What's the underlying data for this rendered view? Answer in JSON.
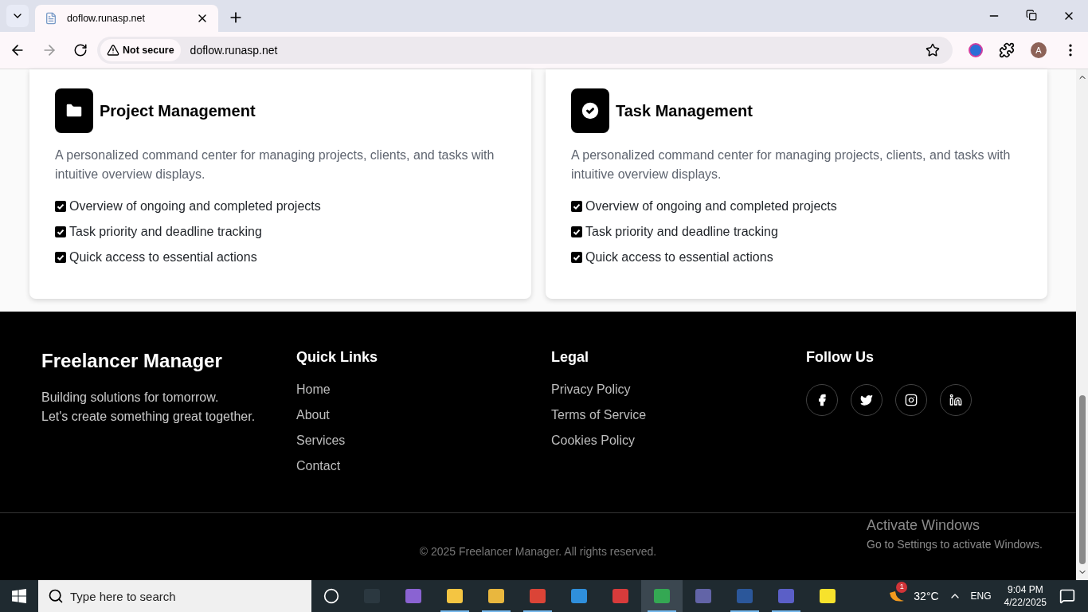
{
  "browser": {
    "tab_title": "doflow.runasp.net",
    "security": "Not secure",
    "url": "doflow.runasp.net",
    "profile_initial": "A"
  },
  "cards": [
    {
      "kind": "folder",
      "title": "Project Management",
      "description": "A personalized command center for managing projects, clients, and tasks with intuitive overview displays.",
      "features": [
        "Overview of ongoing and completed projects",
        "Task priority and deadline tracking",
        "Quick access to essential actions"
      ]
    },
    {
      "kind": "check",
      "title": "Task Management",
      "description": "A personalized command center for managing projects, clients, and tasks with intuitive overview displays.",
      "features": [
        "Overview of ongoing and completed projects",
        "Task priority and deadline tracking",
        "Quick access to essential actions"
      ]
    }
  ],
  "footer": {
    "brand": "Freelancer Manager",
    "tagline": [
      "Building solutions for tomorrow.",
      "Let's create something great together."
    ],
    "columns": [
      {
        "title": "Quick Links",
        "links": [
          "Home",
          "About",
          "Services",
          "Contact"
        ]
      },
      {
        "title": "Legal",
        "links": [
          "Privacy Policy",
          "Terms of Service",
          "Cookies Policy"
        ]
      }
    ],
    "follow_title": "Follow Us",
    "copyright": "© 2025 Freelancer Manager. All rights reserved."
  },
  "activation": {
    "title": "Activate Windows",
    "subtitle": "Go to Settings to activate Windows."
  },
  "taskbar": {
    "search_placeholder": "Type here to search",
    "weather_badge": "1",
    "temperature": "32°C",
    "language": "ENG",
    "time": "9:04 PM",
    "date": "4/22/2025"
  }
}
